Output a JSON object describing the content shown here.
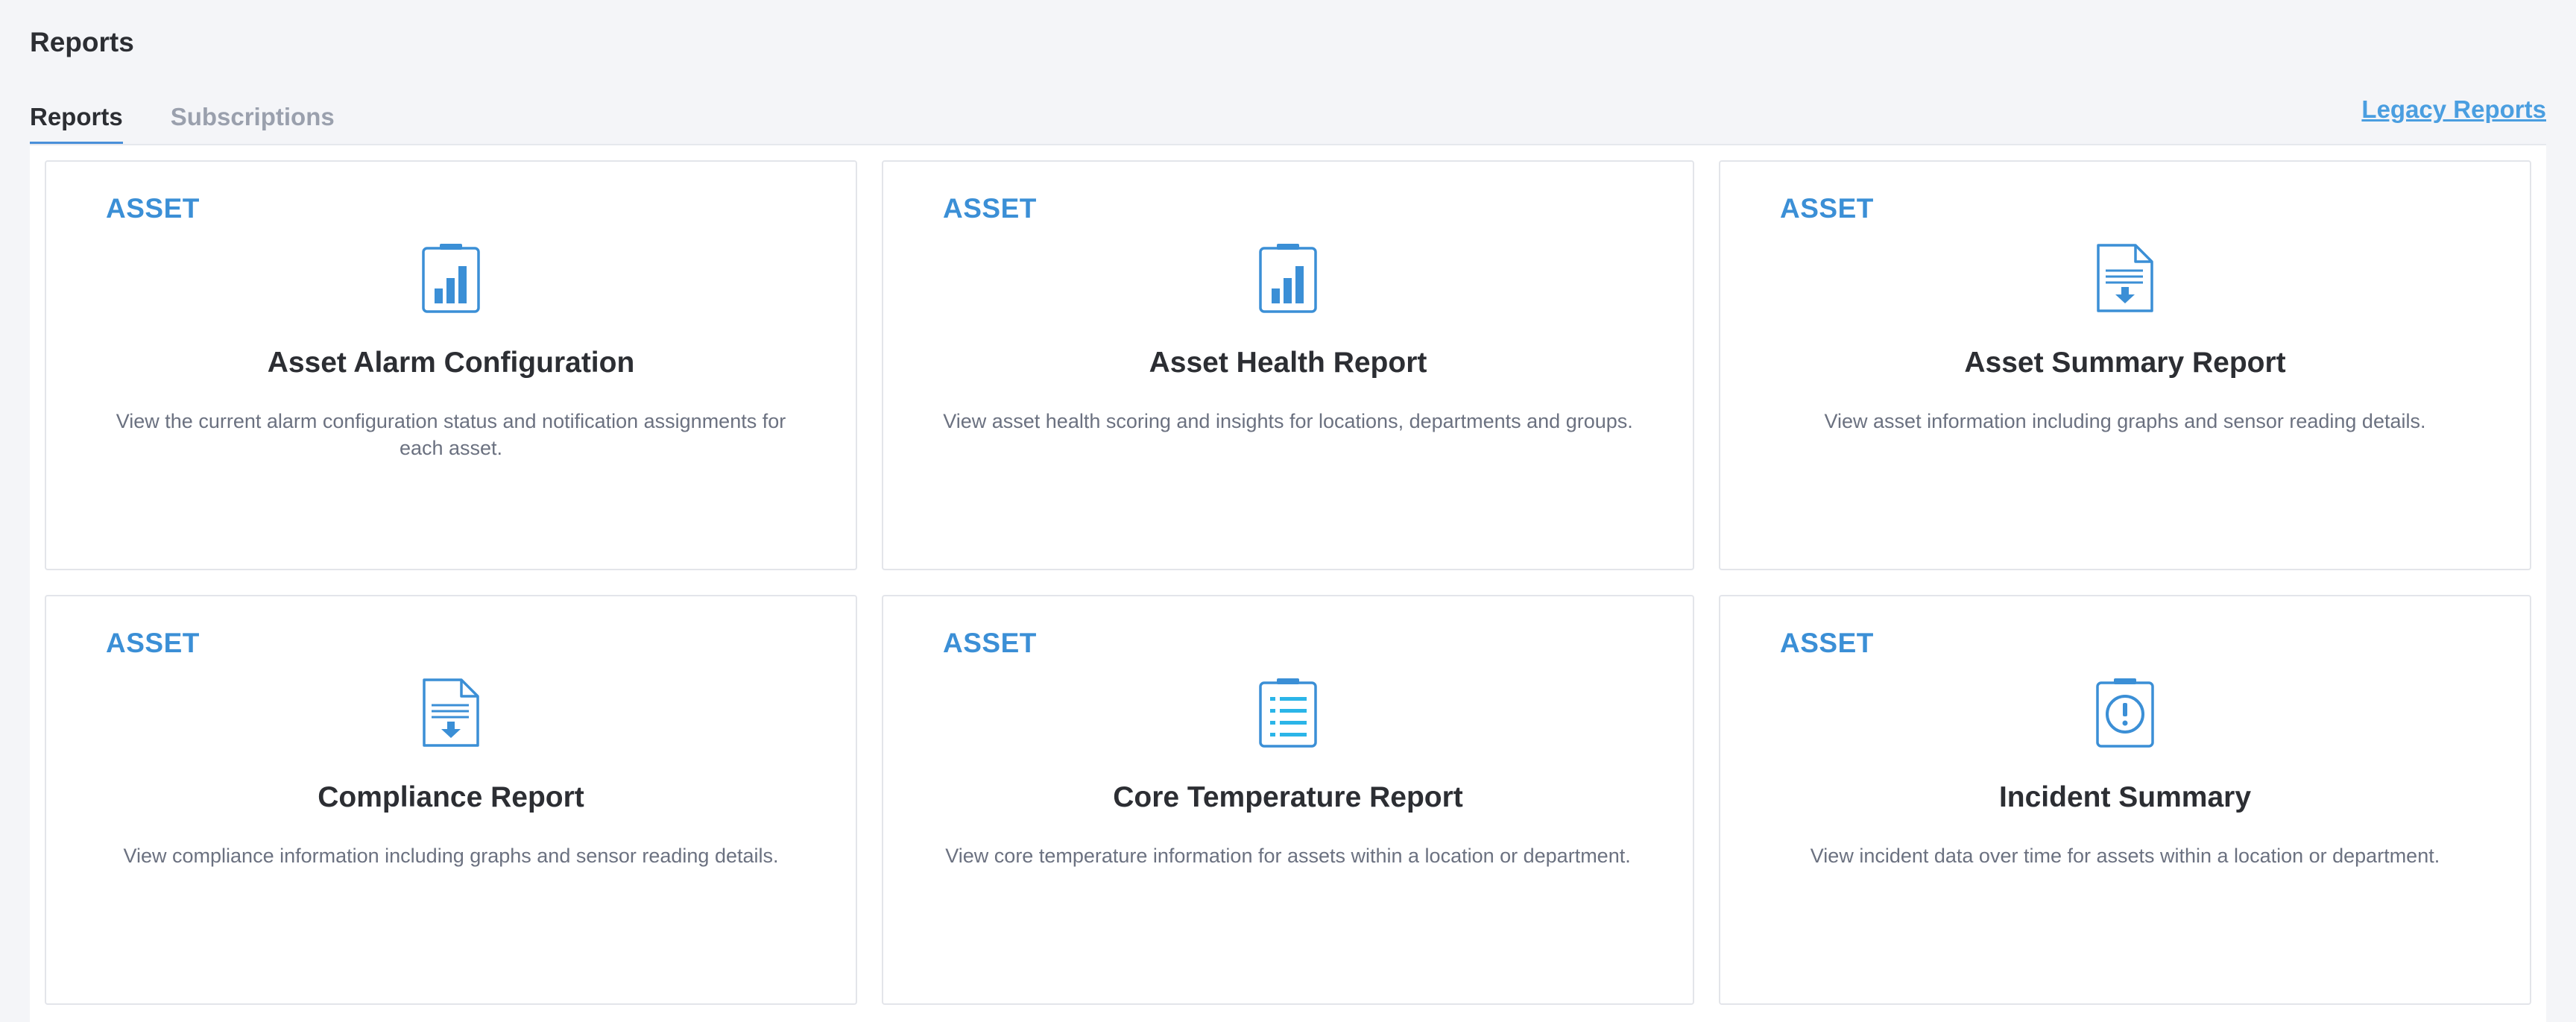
{
  "page": {
    "title": "Reports"
  },
  "tabs": [
    {
      "label": "Reports",
      "active": true
    },
    {
      "label": "Subscriptions",
      "active": false
    }
  ],
  "legacy_link": "Legacy Reports",
  "accent_color": "#3b8fd6",
  "cards": [
    {
      "category": "ASSET",
      "icon": "bar-chart-clipboard-icon",
      "title": "Asset Alarm Configuration",
      "description": "View the current alarm configuration status and notification assignments for each asset."
    },
    {
      "category": "ASSET",
      "icon": "bar-chart-clipboard-icon",
      "title": "Asset Health Report",
      "description": "View asset health scoring and insights for locations, departments and groups."
    },
    {
      "category": "ASSET",
      "icon": "document-download-icon",
      "title": "Asset Summary Report",
      "description": "View asset information including graphs and sensor reading details."
    },
    {
      "category": "ASSET",
      "icon": "document-download-icon",
      "title": "Compliance Report",
      "description": "View compliance information including graphs and sensor reading details."
    },
    {
      "category": "ASSET",
      "icon": "list-clipboard-icon",
      "title": "Core Temperature Report",
      "description": "View core temperature information for assets within a location or department."
    },
    {
      "category": "ASSET",
      "icon": "alert-clipboard-icon",
      "title": "Incident Summary",
      "description": "View incident data over time for assets within a location or department."
    }
  ]
}
